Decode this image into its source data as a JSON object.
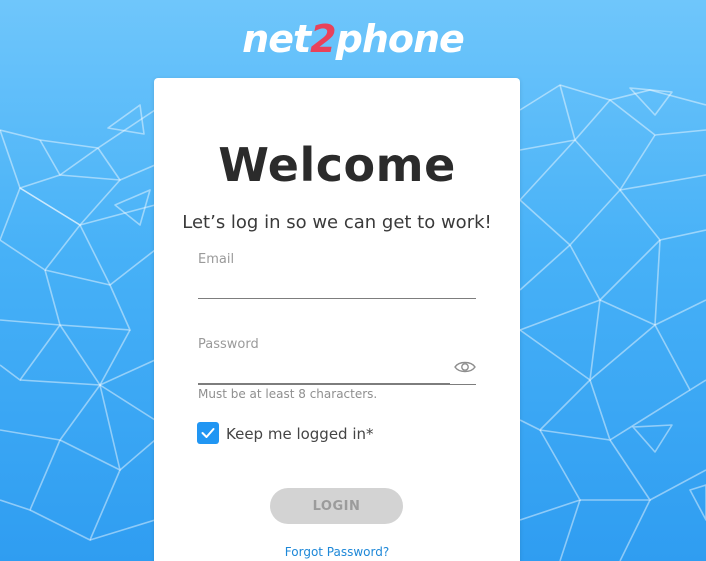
{
  "brand": {
    "logo_part1": "net",
    "logo_part2": "2",
    "logo_part3": "phone",
    "accent_color": "#e8425a",
    "background_color": "#47b1f7"
  },
  "card": {
    "title": "Welcome",
    "subtitle": "Let’s log in so we can get to work!"
  },
  "form": {
    "email_label": "Email",
    "email_value": "",
    "password_label": "Password",
    "password_value": "",
    "password_hint": "Must be at least 8 characters.",
    "password_toggle_icon": "eye-icon",
    "keep_logged_in_label": "Keep me logged in*",
    "keep_logged_in_checked": true,
    "login_label": "LOGIN",
    "forgot_password_label": "Forgot Password?"
  }
}
